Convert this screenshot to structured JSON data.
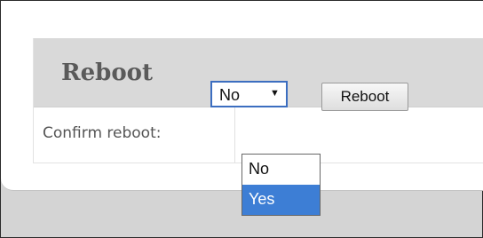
{
  "section": {
    "title": "Reboot"
  },
  "form": {
    "confirm_label": "Confirm reboot:",
    "select_value": "No",
    "select_arrow": "▼",
    "options": [
      {
        "label": "No",
        "selected": false
      },
      {
        "label": "Yes",
        "selected": true
      }
    ],
    "button_label": "Reboot"
  },
  "colors": {
    "header_bg": "#d9d9d9",
    "highlight": "#3d7ed5",
    "select_border": "#3c6ec0"
  }
}
